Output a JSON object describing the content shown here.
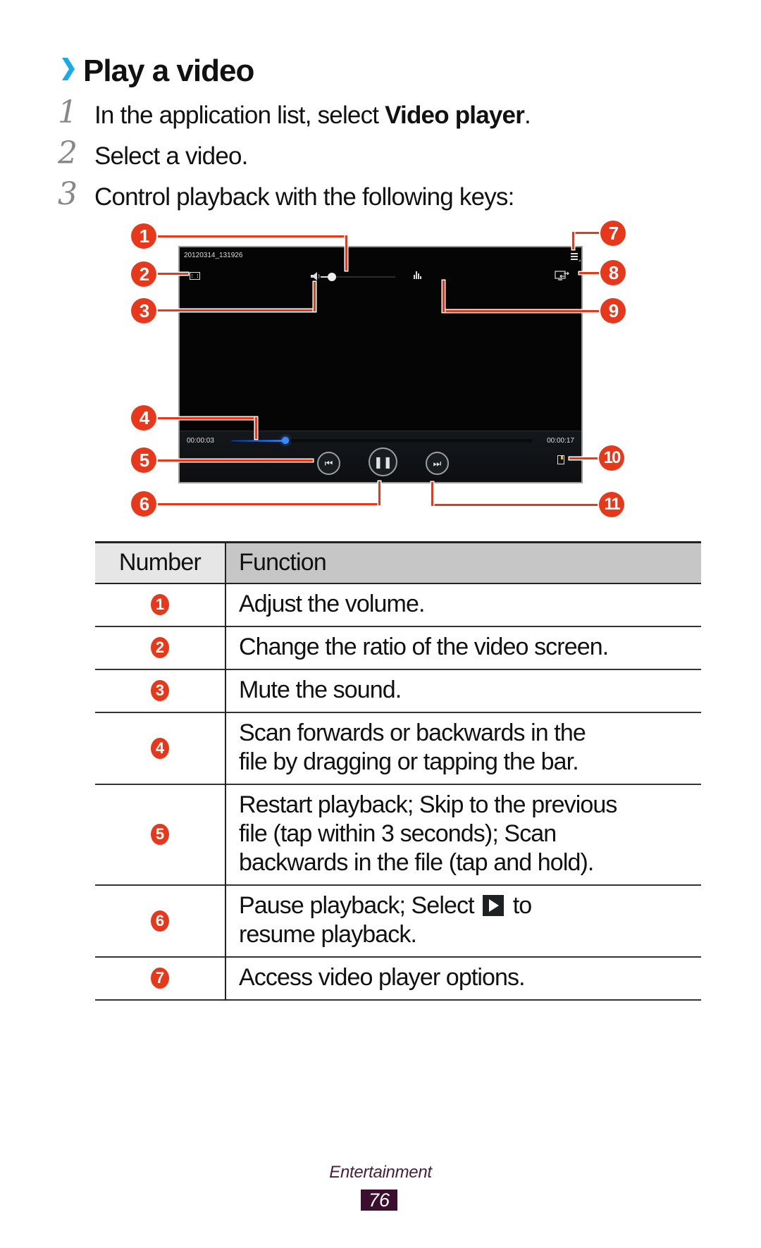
{
  "heading": {
    "chevron_color": "#1aaae8",
    "title": "Play a video"
  },
  "steps": [
    {
      "number": "1",
      "text_before": "In the application list, select ",
      "bold": "Video player",
      "text_after": "."
    },
    {
      "number": "2",
      "text": "Select a video."
    },
    {
      "number": "3",
      "text": "Control playback with the following keys:"
    }
  ],
  "player": {
    "file_name": "20120314_131926",
    "current_time": "00:00:03",
    "total_time": "00:00:17",
    "progress_fraction": 0.18,
    "volume_fraction": 0.05,
    "icons": {
      "ratio": "screen-ratio-icon",
      "mute": "speaker-icon",
      "volume": "volume-slider",
      "equalizer": "sound-effect-icon",
      "options": "menu-icon",
      "share": "allshare-screen-icon",
      "bookmark": "bookmark-icon",
      "rewind": "previous-track-icon",
      "pause": "pause-icon",
      "forward": "next-track-icon"
    }
  },
  "callouts": [
    "1",
    "2",
    "3",
    "4",
    "5",
    "6",
    "7",
    "8",
    "9",
    "10",
    "11"
  ],
  "callout_color": "#e8381b",
  "table": {
    "headers": [
      "Number",
      "Function"
    ],
    "rows": [
      {
        "num": "1",
        "function": "Adjust the volume."
      },
      {
        "num": "2",
        "function": "Change the ratio of the video screen."
      },
      {
        "num": "3",
        "function": "Mute the sound."
      },
      {
        "num": "4",
        "function": "Scan forwards or backwards in the file by dragging or tapping the bar."
      },
      {
        "num": "5",
        "function": "Restart playback; Skip to the previous file (tap within 3 seconds); Scan backwards in the file (tap and hold)."
      },
      {
        "num": "6",
        "function_before": "Pause playback; Select ",
        "function_after": " to resume playback."
      },
      {
        "num": "7",
        "function": "Access video player options."
      }
    ]
  },
  "footer": {
    "section": "Entertainment",
    "page": "76"
  }
}
